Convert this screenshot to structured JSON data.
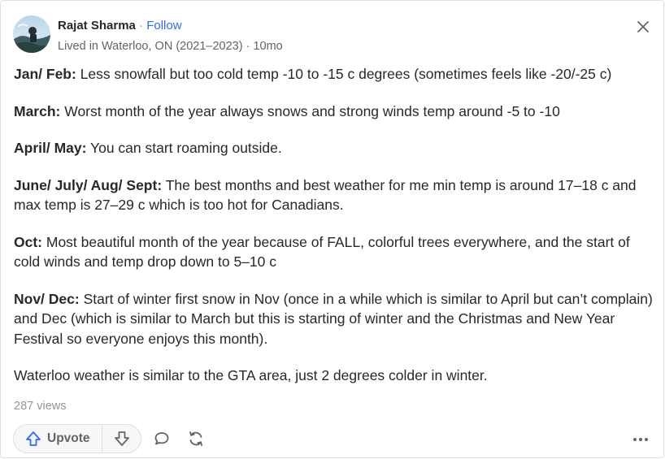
{
  "author": {
    "name": "Rajat Sharma",
    "separator": " · ",
    "follow_label": "Follow",
    "credential": "Lived in Waterloo, ON (2021–2023) · 10mo"
  },
  "answer": {
    "paragraphs": [
      {
        "heading": "Jan/ Feb:",
        "text": " Less snowfall but too cold temp -10 to -15 c degrees (sometimes feels like -20/-25 c)"
      },
      {
        "heading": "March:",
        "text": " Worst month of the year always snows and strong winds temp around -5 to -10"
      },
      {
        "heading": "April/ May:",
        "text": " You can start roaming outside."
      },
      {
        "heading": "June/ July/ Aug/ Sept:",
        "text": " The best months and best weather for me min temp is around 17–18 c and max temp is 27–29 c which is too hot for Canadians."
      },
      {
        "heading": "Oct:",
        "text": " Most beautiful month of the year because of FALL, colorful trees everywhere, and the start of cold winds and temp drop down to 5–10 c"
      },
      {
        "heading": "Nov/ Dec:",
        "text": " Start of winter first snow in Nov (once in a while which is similar to April but can’t complain) and Dec (which is similar to March but this is starting of winter and the Christmas and New Year Festival so everyone enjoys this month)."
      },
      {
        "heading": "",
        "text": "Waterloo weather is similar to the GTA area, just 2 degrees colder in winter."
      }
    ],
    "views": "287 views"
  },
  "actions": {
    "upvote_label": "Upvote",
    "icons": {
      "upvote": "upvote-arrow-icon",
      "downvote": "downvote-arrow-icon",
      "comment": "comment-bubble-icon",
      "share": "share-reload-icon",
      "more": "more-dots-icon",
      "close": "close-icon"
    }
  },
  "colors": {
    "accent": "#2e69ff",
    "text": "#282829",
    "muted": "#636466",
    "light": "#939598",
    "border": "#dee0e1"
  }
}
